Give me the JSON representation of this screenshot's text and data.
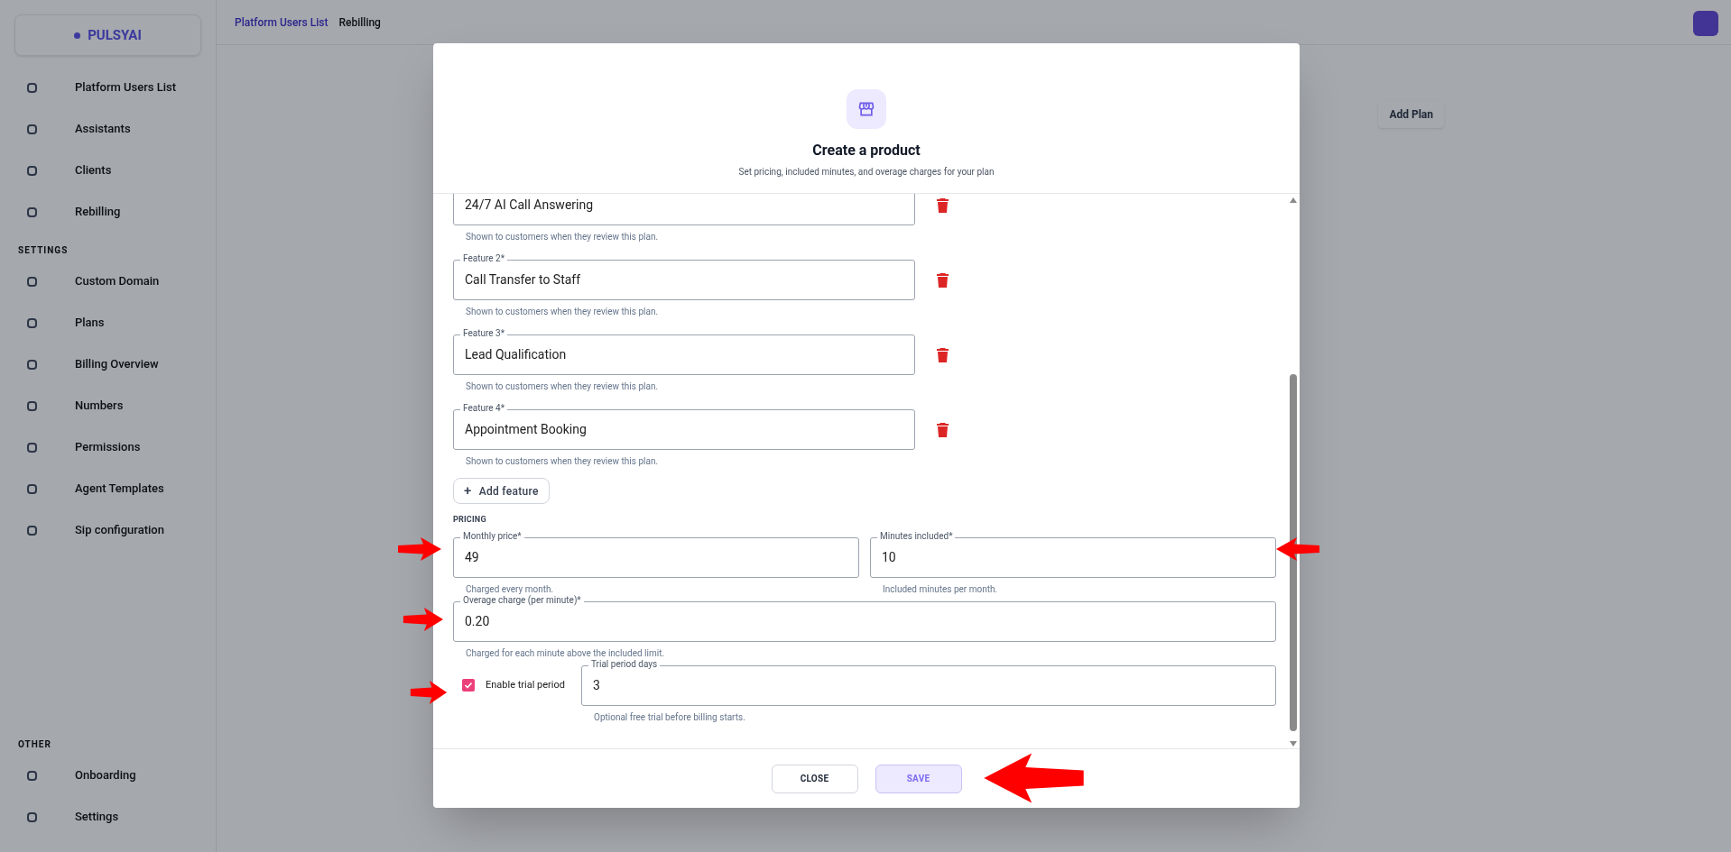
{
  "sidebar": {
    "logo": "PULSYAI",
    "groups": [
      {
        "items": [
          {
            "label": "Platform Users List"
          },
          {
            "label": "Assistants"
          },
          {
            "label": "Clients"
          },
          {
            "label": "Rebilling"
          }
        ]
      },
      {
        "heading": "SETTINGS",
        "items": [
          {
            "label": "Custom Domain"
          },
          {
            "label": "Plans"
          },
          {
            "label": "Billing Overview"
          },
          {
            "label": "Numbers"
          },
          {
            "label": "Permissions"
          },
          {
            "label": "Agent Templates"
          },
          {
            "label": "Sip configuration"
          }
        ]
      },
      {
        "heading": "OTHER",
        "items": [
          {
            "label": "Onboarding"
          },
          {
            "label": "Settings"
          }
        ]
      }
    ]
  },
  "breadcrumb": [
    "Platform Users List",
    "Rebilling"
  ],
  "add_plan_button": "Add Plan",
  "dialog": {
    "title": "Create a product",
    "subtitle": "Set pricing, included minutes, and overage charges for your plan",
    "features": [
      {
        "value": "24/7 AI Call Answering",
        "helper": "Shown to customers when they review this plan."
      },
      {
        "label": "Feature 2*",
        "value": "Call Transfer to Staff",
        "helper": "Shown to customers when they review this plan."
      },
      {
        "label": "Feature 3*",
        "value": "Lead Qualification",
        "helper": "Shown to customers when they review this plan."
      },
      {
        "label": "Feature 4*",
        "value": "Appointment Booking",
        "helper": "Shown to customers when they review this plan."
      }
    ],
    "add_feature": {
      "icon": "+",
      "label": "Add feature"
    },
    "pricing_heading": "PRICING",
    "price_fields": [
      {
        "label": "Monthly price*",
        "value": "49",
        "helper": "Charged every month."
      },
      {
        "label": "Minutes included*",
        "value": "10",
        "helper": "Included minutes per month."
      }
    ],
    "overage_field": {
      "label": "Overage charge (per minute)*",
      "value": "0.20",
      "helper": "Charged for each minute above the included limit."
    },
    "trial": {
      "label": "Enable trial period",
      "checked": true
    },
    "trial_field": {
      "label": "Trial period days",
      "value": "3",
      "helper": "Optional free trial before billing starts."
    },
    "buttons": [
      {
        "label": "CLOSE",
        "kind": "outline"
      },
      {
        "label": "SAVE",
        "kind": "primary"
      }
    ]
  }
}
